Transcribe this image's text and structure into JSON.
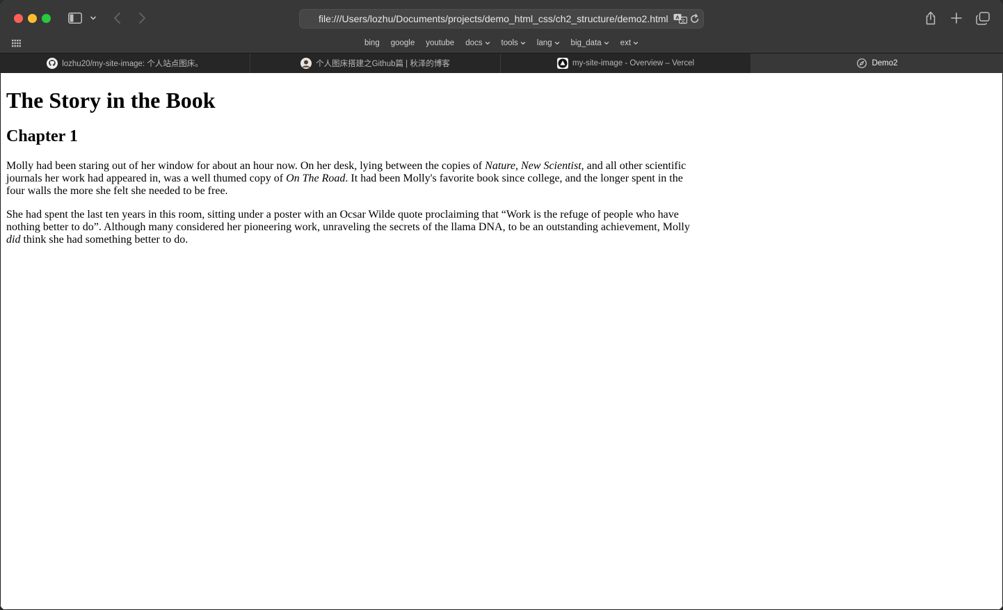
{
  "browser": {
    "url": "file:///Users/lozhu/Documents/projects/demo_html_css/ch2_structure/demo2.html",
    "favorites": [
      {
        "label": "bing",
        "has_menu": false
      },
      {
        "label": "google",
        "has_menu": false
      },
      {
        "label": "youtube",
        "has_menu": false
      },
      {
        "label": "docs",
        "has_menu": true
      },
      {
        "label": "tools",
        "has_menu": true
      },
      {
        "label": "lang",
        "has_menu": true
      },
      {
        "label": "big_data",
        "has_menu": true
      },
      {
        "label": "ext",
        "has_menu": true
      }
    ],
    "tabs": [
      {
        "title": "lozhu20/my-site-image: 个人站点图床。",
        "icon": "github-icon",
        "active": false
      },
      {
        "title": "个人图床搭建之Github篇 | 秋泽的博客",
        "icon": "avatar-icon",
        "active": false
      },
      {
        "title": "my-site-image - Overview – Vercel",
        "icon": "vercel-icon",
        "active": false
      },
      {
        "title": "Demo2",
        "icon": "compass-icon",
        "active": true
      }
    ]
  },
  "page": {
    "title": "The Story in the Book",
    "chapter": "Chapter 1",
    "p1": {
      "t1": "Molly had been staring out of her window for about an hour now. On her desk, lying between the copies of ",
      "i1": "Nature",
      "t2": ", ",
      "i2": "New Scientist",
      "t3": ", and all other scientific journals her work had appeared in, was a well thumed copy of ",
      "i3": "On The Road",
      "t4": ". It had been Molly's favorite book since college, and the longer spent in the four walls the more she felt she needed to be free."
    },
    "p2": {
      "t1": "She had spent the last ten years in this room, sitting under a poster with an Ocsar Wilde quote proclaiming that “Work is the refuge of people who have nothing better to do”. Although many considered her pioneering work, unraveling the secrets of the llama DNA, to be an outstanding achievement, Molly ",
      "i1": "did",
      "t2": " think she had something better to do."
    }
  },
  "colors": {
    "close": "#ff5f57",
    "minimize": "#febc2e",
    "maximize": "#28c840",
    "chrome": "#383838"
  }
}
